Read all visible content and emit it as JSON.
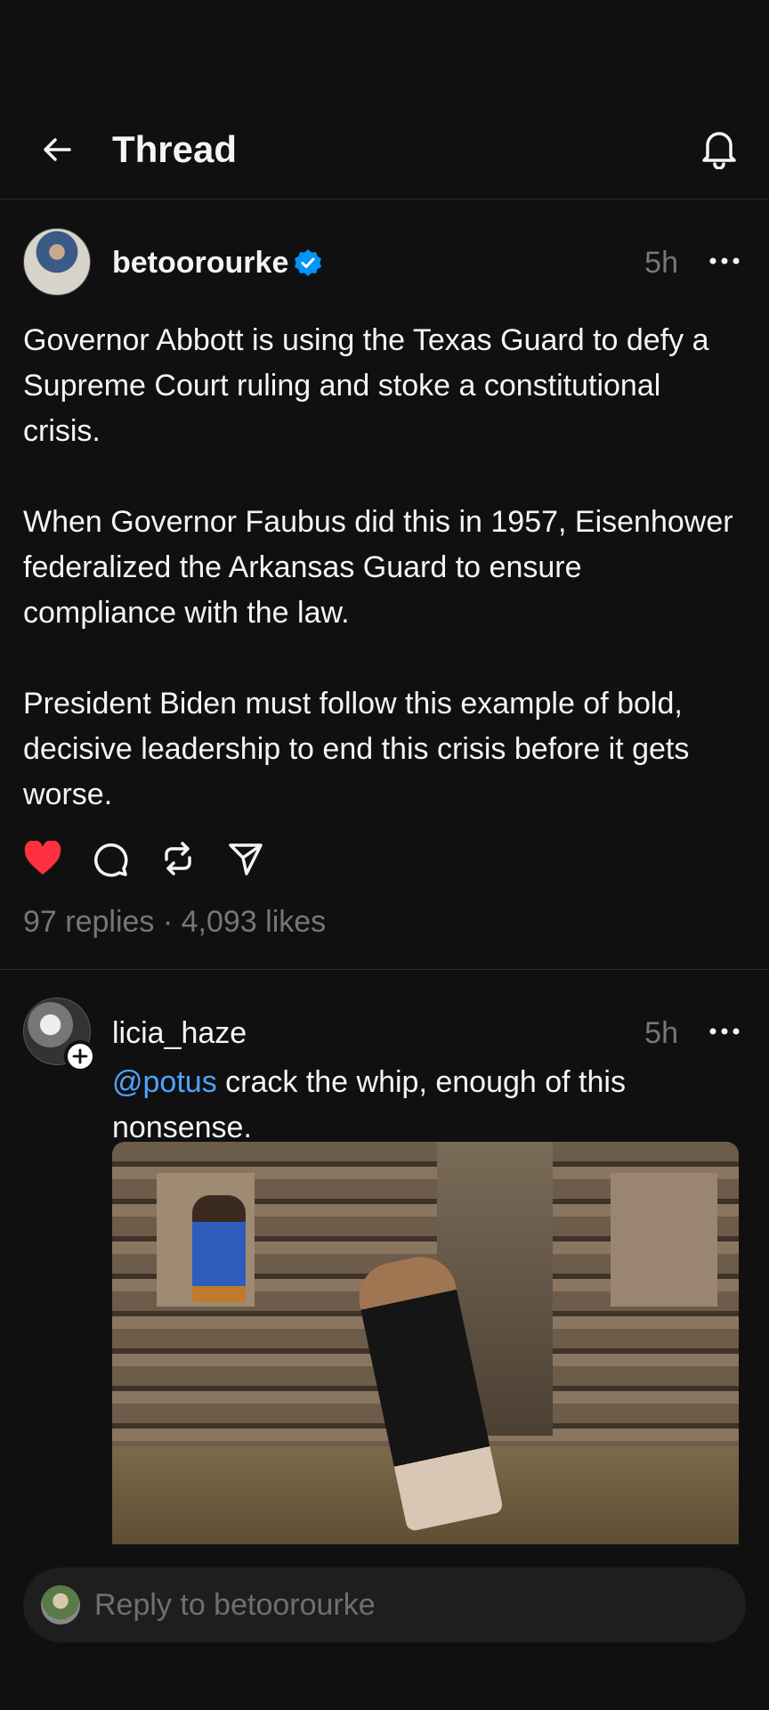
{
  "header": {
    "title": "Thread",
    "back_icon": "arrow-left-icon",
    "bell_icon": "bell-icon"
  },
  "post": {
    "username": "betoorourke",
    "verified": true,
    "time": "5h",
    "body": "Governor Abbott is using the Texas Guard to defy a Supreme Court ruling and stoke a constitutional crisis.\n\nWhen Governor Faubus did this in 1957, Eisenhower federalized the Arkansas Guard to ensure compliance with the law.\n\nPresident Biden must follow this example of bold, decisive leadership to end this crisis before it gets worse.",
    "liked": true,
    "stats": "97 replies · 4,093 likes"
  },
  "reply": {
    "username": "licia_haze",
    "time": "5h",
    "mention": "@potus",
    "text": " crack the whip, enough of this nonsense."
  },
  "composer": {
    "placeholder": "Reply to betoorourke"
  },
  "colors": {
    "background": "#101010",
    "like": "#ff3040",
    "verified": "#0095f6",
    "mention": "#4da3ff"
  }
}
